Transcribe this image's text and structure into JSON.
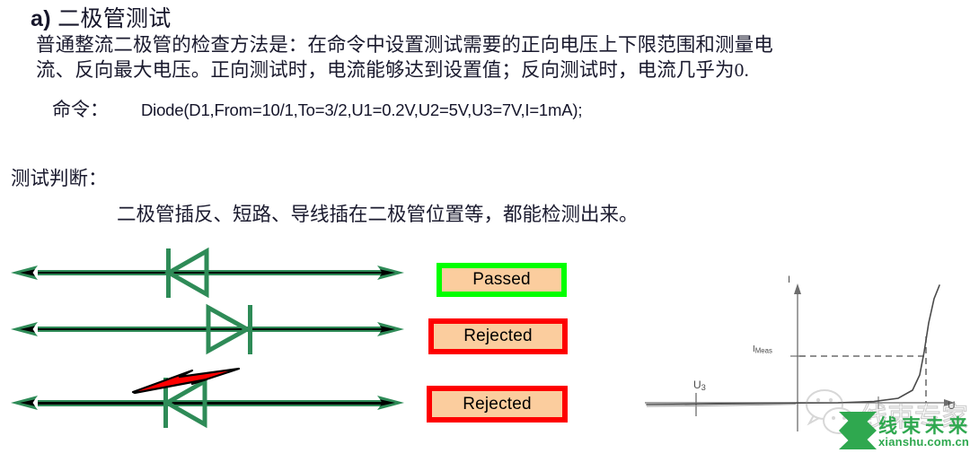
{
  "slide": {
    "heading_prefix": "a)",
    "heading_title": "二极管测试",
    "paragraph_lines": [
      "普通整流二极管的检查方法是：在命令中设置测试需要的正向电压上下限范围和测量电",
      "流、反向最大电压。正向测试时，电流能够达到设置值；反向测试时，电流几乎为0."
    ],
    "command_label": "命令：",
    "command_text": "Diode(D1,From=10/1,To=3/2,U1=0.2V,U2=5V,U3=7V,I=1mA);",
    "verdict_title": "测试判断：",
    "verdict_body": "二极管插反、短路、导线插在二极管位置等，都能检测出来。"
  },
  "diagram": {
    "rows": [
      {
        "name": "reverse-diode-row",
        "orientation": "reverse",
        "fault": "none"
      },
      {
        "name": "forward-diode-row",
        "orientation": "forward",
        "fault": "none"
      },
      {
        "name": "shorted-diode-row",
        "orientation": "reverse",
        "fault": "short-circuit-spark"
      }
    ],
    "wire_color": "#2e8b57",
    "arrow_core_color": "#000000",
    "spark_color": "#fe0000"
  },
  "badges": [
    {
      "label": "Passed",
      "border_color": "#00ff00",
      "fill_color": "#fbcd9e"
    },
    {
      "label": "Rejected",
      "border_color": "#fe0000",
      "fill_color": "#fbcd9e"
    },
    {
      "label": "Rejected",
      "border_color": "#fe0000",
      "fill_color": "#fbcd9e"
    }
  ],
  "chart_data": {
    "type": "line",
    "title": "",
    "xlabel": "U",
    "ylabel": "I",
    "grid": false,
    "legend": null,
    "axis_label_y": "I",
    "axis_label_x": "U",
    "annotations": [
      {
        "text": "U",
        "sub": "3",
        "role": "reverse-breakdown-tick",
        "x": -2.6,
        "y": 0
      },
      {
        "text": "I",
        "sub": "Meas",
        "role": "measured-current-level",
        "x": 0,
        "y": 1.0
      }
    ],
    "xlim": [
      -4.2,
      3.4
    ],
    "ylim": [
      -0.55,
      2.6
    ],
    "series": [
      {
        "name": "diode-iv-curve",
        "color": "#555555",
        "x": [
          -4.2,
          -3.4,
          -2.6,
          -1.8,
          -1.0,
          -0.4,
          0.0,
          0.6,
          1.2,
          1.7,
          2.0,
          2.2,
          2.4,
          2.55,
          2.7,
          2.85,
          3.0
        ],
        "y": [
          -0.03,
          -0.03,
          -0.02,
          -0.02,
          -0.01,
          0.0,
          0.0,
          0.0,
          0.01,
          0.04,
          0.1,
          0.22,
          0.5,
          0.82,
          1.25,
          1.9,
          2.5
        ]
      }
    ],
    "reference_lines": [
      {
        "name": "imeas-horizontal-dashed",
        "orientation": "horizontal",
        "value": 1.0,
        "style": "dashed"
      },
      {
        "name": "vmeas-vertical-dashed",
        "orientation": "vertical",
        "value": 2.62,
        "style": "dashed"
      }
    ]
  },
  "watermark": {
    "wechat_text": "线束专家",
    "brand_cn": "线束未来",
    "brand_url": "xianshu.com.cn",
    "brand_color": "#2fa84f"
  }
}
